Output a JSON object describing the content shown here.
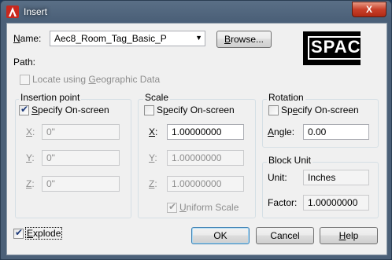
{
  "window": {
    "title": "Insert",
    "close_glyph": "X"
  },
  "name": {
    "label": "Name:",
    "value": "Aec8_Room_Tag_Basic_P",
    "browse_label": "Browse...",
    "preview_text": "SPAC"
  },
  "path": {
    "label": "Path:",
    "locate_label": "Locate using Geographic Data"
  },
  "insertion": {
    "title": "Insertion point",
    "specify_label": "Specify On-screen",
    "x_label": "X:",
    "x_value": "0\"",
    "y_label": "Y:",
    "y_value": "0\"",
    "z_label": "Z:",
    "z_value": "0\""
  },
  "scale": {
    "title": "Scale",
    "specify_label": "Specify On-screen",
    "x_label": "X:",
    "x_value": "1.00000000",
    "y_label": "Y:",
    "y_value": "1.00000000",
    "z_label": "Z:",
    "z_value": "1.00000000",
    "uniform_label": "Uniform Scale"
  },
  "rotation": {
    "title": "Rotation",
    "specify_label": "Specify On-screen",
    "angle_label": "Angle:",
    "angle_value": "0.00"
  },
  "block_unit": {
    "title": "Block Unit",
    "unit_label": "Unit:",
    "unit_value": "Inches",
    "factor_label": "Factor:",
    "factor_value": "1.00000000"
  },
  "footer": {
    "explode_label": "Explode",
    "ok_label": "OK",
    "cancel_label": "Cancel",
    "help_label": "Help"
  },
  "colors": {
    "title_bar": "#4b6078",
    "close_button": "#c8402a",
    "dialog_bg": "#f0f0f0",
    "app_icon": "#c8281e"
  }
}
